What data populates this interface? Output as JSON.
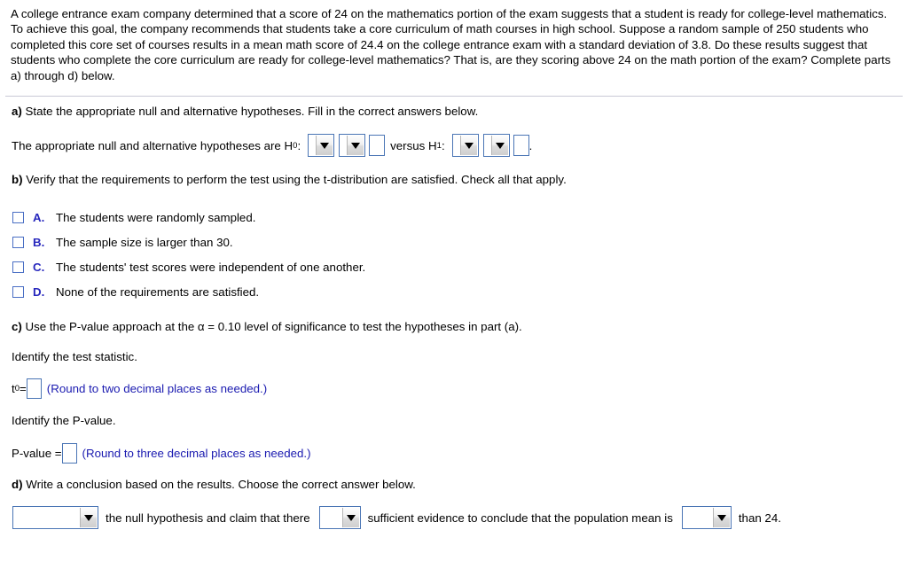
{
  "problem": {
    "text": "A college entrance exam company determined that a score of 24 on the mathematics portion of the exam suggests that a student is ready for college-level mathematics. To achieve this goal, the company recommends that students take a core curriculum of math courses in high school. Suppose a random sample of 250 students who completed this core set of courses results in a mean math score of 24.4 on the college entrance exam with a standard deviation of 3.8. Do these results suggest that students who complete the core curriculum are ready for college-level mathematics? That is, are they scoring above 24 on the math portion of the exam? Complete parts a) through d) below."
  },
  "parts": {
    "a": {
      "label": "a)",
      "prompt": " State the appropriate null and alternative hypotheses. Fill in the correct answers below.",
      "sentence_lead": "The appropriate null and alternative hypotheses are H",
      "h0_sub": "0",
      "colon": ":",
      "versus": "versus H",
      "h1_sub": "1",
      "period": "."
    },
    "b": {
      "label": "b)",
      "prompt": " Verify that the requirements to perform the test using the t-distribution are satisfied. Check all that apply.",
      "choices": [
        {
          "letter": "A.",
          "text": "The students were randomly sampled."
        },
        {
          "letter": "B.",
          "text": "The sample size is larger than 30."
        },
        {
          "letter": "C.",
          "text": "The students' test scores were independent of one another."
        },
        {
          "letter": "D.",
          "text": "None of the requirements are satisfied."
        }
      ]
    },
    "c": {
      "label": "c)",
      "prompt": " Use the P-value approach at the α = 0.10 level of significance to test the hypotheses in part (a).",
      "identify_statistic": "Identify the test statistic.",
      "t_label": "t",
      "t_sub": "0",
      "t_equals": " = ",
      "t_value": "",
      "t_hint": "(Round to two decimal places as needed.)",
      "identify_pvalue": "Identify the P-value.",
      "p_label": "P-value = ",
      "p_value": "",
      "p_hint": "(Round to three decimal places as needed.)"
    },
    "d": {
      "label": "d)",
      "prompt": " Write a conclusion based on the results. Choose the correct answer below.",
      "dropdown1_value": "",
      "text1": "the null hypothesis and claim that there",
      "dropdown2_value": "",
      "text2": "sufficient evidence to conclude that the population mean is",
      "dropdown3_value": "",
      "text3": "than 24."
    }
  },
  "colors": {
    "hint_blue": "#1a1ab0",
    "choice_letter_blue": "#2727bd",
    "field_border_blue": "#4a75b5",
    "divider_gray": "#c9c9d6",
    "background": "#ffffff"
  }
}
